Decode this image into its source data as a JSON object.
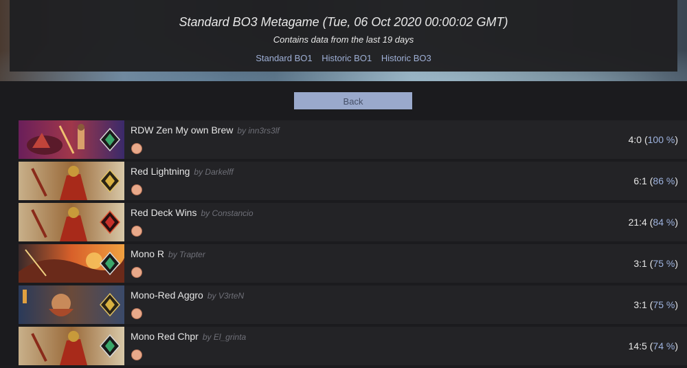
{
  "header": {
    "title": "Standard BO3 Metagame (Tue, 06 Oct 2020 00:00:02 GMT)",
    "subtitle": "Contains data from the last 19 days",
    "format_links": [
      "Standard BO1",
      "Historic BO1",
      "Historic BO3"
    ]
  },
  "back_button": "Back",
  "decks": [
    {
      "name": "RDW Zen My own Brew",
      "author": "by inn3rs3lf",
      "record": "4:0",
      "percent": "100 %",
      "rank": "emerald",
      "art": "crimson-riders",
      "mana": "red-mana-icon"
    },
    {
      "name": "Red Lightning",
      "author": "by Darkelff",
      "record": "6:1",
      "percent": "86 %",
      "rank": "gold",
      "art": "red-warrior",
      "mana": "red-mana-icon"
    },
    {
      "name": "Red Deck Wins",
      "author": "by Constancio",
      "record": "21:4",
      "percent": "84 %",
      "rank": "mythic",
      "art": "red-warrior",
      "mana": "red-mana-icon"
    },
    {
      "name": "Mono R",
      "author": "by Trapter",
      "record": "3:1",
      "percent": "75 %",
      "rank": "emerald",
      "art": "fire-dragon",
      "mana": "red-mana-icon"
    },
    {
      "name": "Mono-Red Aggro",
      "author": "by V3rteN",
      "record": "3:1",
      "percent": "75 %",
      "rank": "gold",
      "art": "dwarf-warrior",
      "mana": "red-mana-icon"
    },
    {
      "name": "Mono Red Chpr",
      "author": "by El_grinta",
      "record": "14:5",
      "percent": "74 %",
      "rank": "emerald",
      "art": "red-warrior",
      "mana": "red-mana-icon"
    }
  ],
  "colors": {
    "link": "#9fb0d6",
    "button_bg": "#9aa9cc",
    "percent": "#9fb4e0",
    "author": "#6f7078",
    "row_bg": "#232326"
  }
}
